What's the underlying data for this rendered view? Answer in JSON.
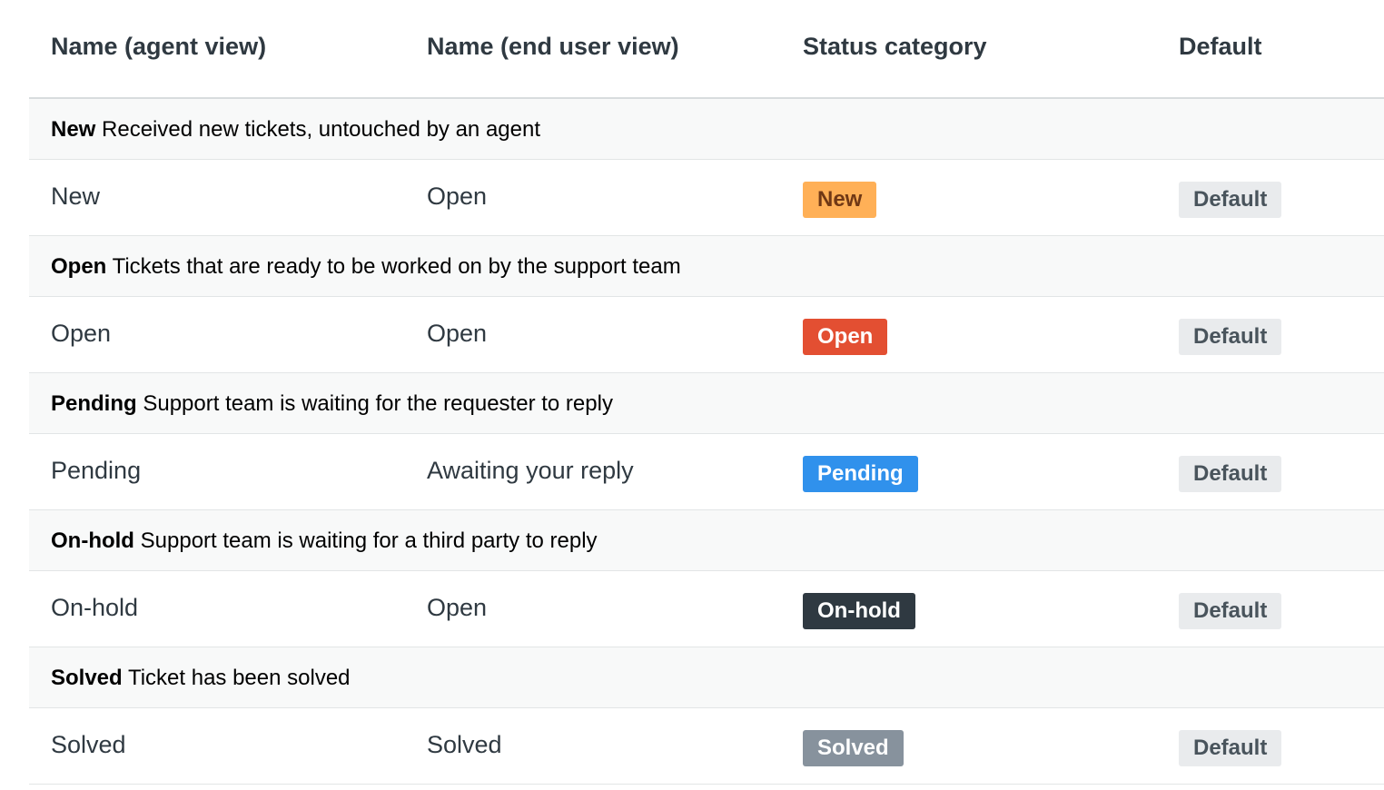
{
  "headers": {
    "agent_view": "Name (agent view)",
    "end_user_view": "Name (end user view)",
    "status_category": "Status category",
    "default": "Default"
  },
  "groups": [
    {
      "name": "New",
      "description": "Received new tickets, untouched by an agent",
      "row": {
        "agent_name": "New",
        "end_user_name": "Open",
        "category": "New",
        "category_color": "#ffb057",
        "default_label": "Default"
      }
    },
    {
      "name": "Open",
      "description": "Tickets that are ready to be worked on by the support team",
      "row": {
        "agent_name": "Open",
        "end_user_name": "Open",
        "category": "Open",
        "category_color": "#e34f32",
        "default_label": "Default"
      }
    },
    {
      "name": "Pending",
      "description": "Support team is waiting for the requester to reply",
      "row": {
        "agent_name": "Pending",
        "end_user_name": "Awaiting your reply",
        "category": "Pending",
        "category_color": "#3091ec",
        "default_label": "Default"
      }
    },
    {
      "name": "On-hold",
      "description": "Support team is waiting for a third party to reply",
      "row": {
        "agent_name": "On-hold",
        "end_user_name": "Open",
        "category": "On-hold",
        "category_color": "#2f3941",
        "default_label": "Default"
      }
    },
    {
      "name": "Solved",
      "description": "Ticket has been solved",
      "row": {
        "agent_name": "Solved",
        "end_user_name": "Solved",
        "category": "Solved",
        "category_color": "#87929d",
        "default_label": "Default"
      }
    }
  ]
}
